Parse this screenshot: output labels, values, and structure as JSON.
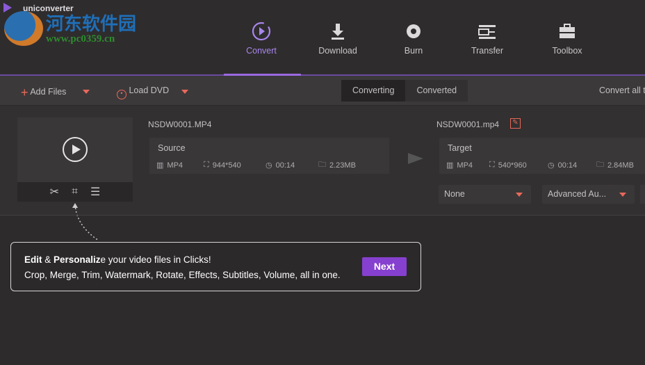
{
  "app": {
    "title": "uniconverter",
    "watermark": "河东软件园",
    "watermark_url": "www.pc0359.cn"
  },
  "nav": [
    {
      "label": "Convert",
      "icon": "convert-icon",
      "active": true
    },
    {
      "label": "Download",
      "icon": "download-icon"
    },
    {
      "label": "Burn",
      "icon": "burn-icon"
    },
    {
      "label": "Transfer",
      "icon": "transfer-icon"
    },
    {
      "label": "Toolbox",
      "icon": "toolbox-icon"
    }
  ],
  "toolbar": {
    "add_files": "Add Files",
    "load_dvd": "Load DVD",
    "tabs": [
      "Converting",
      "Converted"
    ],
    "convert_all": "Convert all t"
  },
  "file": {
    "source_name": "NSDW0001.MP4",
    "source_label": "Source",
    "source": {
      "format": "MP4",
      "resolution": "944*540",
      "duration": "00:14",
      "size": "2.23MB"
    },
    "target_name": "NSDW0001.mp4",
    "target_label": "Target",
    "target": {
      "format": "MP4",
      "resolution": "540*960",
      "duration": "00:14",
      "size": "2.84MB"
    },
    "subtitle_select": "None",
    "audio_select": "Advanced Au..."
  },
  "tip": {
    "bold1": "Edit",
    "amp": " & ",
    "bold2": "Personaliz",
    "rest": "e your video files in Clicks!",
    "line2": "Crop, Merge, Trim, Watermark, Rotate, Effects, Subtitles, Volume, all in one.",
    "next": "Next"
  },
  "colors": {
    "accent": "#8640cf",
    "orange": "#e9695a"
  }
}
